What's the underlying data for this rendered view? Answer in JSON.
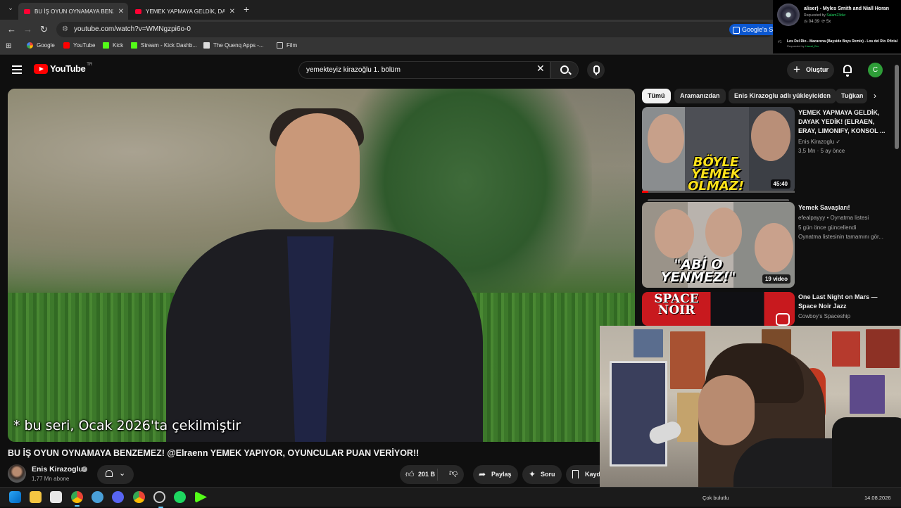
{
  "browser": {
    "tabs": [
      {
        "title": "BU İŞ OYUN OYNAMAYA BENZEMEZ!",
        "active": true
      },
      {
        "title": "YEMEK YAPMAYA GELDİK, DAYAK YEDİK!",
        "active": false
      }
    ],
    "url": "youtube.com/watch?v=WMNgzpi6o-0",
    "google_button": "Google'a S",
    "bookmarks": [
      {
        "label": "Google",
        "icon": "google-icon"
      },
      {
        "label": "YouTube",
        "icon": "youtube-icon"
      },
      {
        "label": "Kick",
        "icon": "kick-icon"
      },
      {
        "label": "Stream - Kick Dashb...",
        "icon": "kick-icon"
      },
      {
        "label": "The Quenq Apps -...",
        "icon": "apps-icon"
      },
      {
        "label": "Film",
        "icon": "folder-icon"
      }
    ]
  },
  "music_overlay": {
    "now_playing": "aliser) - Myles Smith and Niall Horan",
    "requested_label": "Requested by",
    "requested_by": "Salam23dur",
    "time": "04:39",
    "count": "5x",
    "queue_number": "#1",
    "next_song": "Los Del Rio - Macarena (Bayside Boys Remix) - Los del Rio Oficial",
    "next_requested_by": "Hawal_Bro"
  },
  "youtube": {
    "logo_text": "YouTube",
    "country_code": "TR",
    "search_query": "yemekteyiz kirazoğlu 1. bölüm",
    "create_label": "Oluştur",
    "avatar_letter": "C"
  },
  "video": {
    "subtitle": "* bu seri, Ocak 2026'ta çekilmiştir",
    "title": "BU İŞ OYUN OYNAMAYA BENZEMEZ! @Elraenn YEMEK YAPIYOR, OYUNCULAR PUAN VERİYOR!!",
    "channel_name": "Enis Kirazoglu",
    "subscribers": "1,77 Mn abone",
    "likes": "201 B",
    "share_label": "Paylaş",
    "ask_label": "Soru",
    "save_label": "Kaydet"
  },
  "chips": [
    "Tümü",
    "Aramanızdan",
    "Enis Kirazoglu adlı yükleyiciden",
    "Tuğkan"
  ],
  "recommendations": [
    {
      "title": "YEMEK YAPMAYA GELDİK, DAYAK YEDİK! (ELRAEN, ERAY, LIMONIFY, KONSOL ...",
      "channel": "Enis Kirazoglu",
      "meta": "3,5 Mn · 5 ay önce",
      "duration": "45:40",
      "thumb_text": "BÖYLE YEMEK OLMAZ!",
      "watched_fraction": 0.04
    },
    {
      "title": "Yemek Savaşları!",
      "channel": "efealpayyy • Oynatma listesi",
      "meta": "5 gün önce güncellendi",
      "meta2": "Oynatma listesinin tamamını gör...",
      "video_count": "19 video",
      "thumb_text": "\"ABİ O YENMEZ!\""
    },
    {
      "title": "One Last Night on Mars — Space Noir Jazz",
      "channel": "Cowboy's Spaceship",
      "thumb_text": "SPACE NOIR"
    }
  ],
  "taskbar": {
    "weather": "Çok bulutlu",
    "date": "14.08.2026"
  },
  "colors": {
    "youtube_red": "#ff0000",
    "spotify_green": "#1ed760",
    "background": "#0f0f0f"
  }
}
